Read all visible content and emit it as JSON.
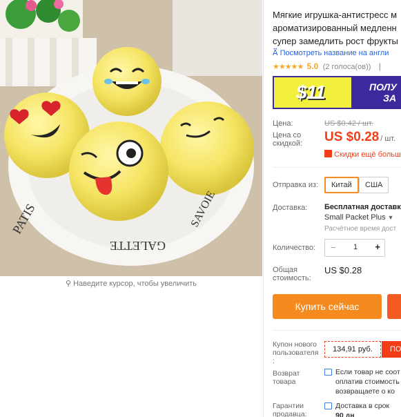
{
  "product": {
    "title_lines": [
      "Мягкие игрушка-антистресс м",
      "ароматизированный медленн",
      "супер замедлить рост фрукты"
    ],
    "translate_link": "Посмотреть название на англи",
    "rating": {
      "stars": "★★★★★",
      "score": "5.0",
      "votes": "(2 голоса(ов))",
      "trail": "|"
    }
  },
  "banner": {
    "price": "$11",
    "text_line1": "ПОЛУ",
    "text_line2": "ЗА"
  },
  "pricing": {
    "old_label": "Цена:",
    "old_price": "US $0.42 / шт.",
    "new_label_line1": "Цена со",
    "new_label_line2": "скидкой:",
    "new_price": "US $0.28",
    "per_unit": "/ шт.",
    "discount_link": "Скидки ещё больш"
  },
  "shipping": {
    "from_label": "Отправка из:",
    "options": [
      "Китай",
      "США"
    ],
    "selected": "Китай",
    "delivery_label": "Доставка:",
    "delivery_main": "Бесплатная доставка",
    "delivery_method": "Small Packet Plus",
    "delivery_time": "Расчётное время дост"
  },
  "quantity": {
    "label": "Количество:",
    "value": "1",
    "minus": "−",
    "plus": "+"
  },
  "total": {
    "label_line1": "Общая",
    "label_line2": "стоимость:",
    "value": "US $0.28"
  },
  "actions": {
    "buy_now": "Купить сейчас"
  },
  "coupon": {
    "label_lines": [
      "Купон нового",
      "пользователя",
      ":"
    ],
    "amount": "134,91 руб.",
    "button": "ПО"
  },
  "returns": {
    "label_lines": [
      "Возврат",
      "товара"
    ],
    "text_lines": [
      "Если товар не соот",
      "оплатив стоимость",
      "возвращаете о ко"
    ]
  },
  "guarantee": {
    "label_lines": [
      "Гарантии",
      "продавца:"
    ],
    "text_lines": [
      "Доставка в срок",
      "90 дн"
    ]
  },
  "image": {
    "zoom_hint": "Наведите курсор, чтобы увеличить",
    "plate_text_left": "PATIS",
    "plate_text_right": "SAVOIE",
    "plate_text_bottom": "GALETTE"
  },
  "colors": {
    "accent_orange": "#f58a1f",
    "price_red": "#f23d18",
    "link_blue": "#2962d9",
    "star_yellow": "#f5a623",
    "banner_purple": "#3a2a9e",
    "banner_yellow": "#f2ef3d"
  }
}
